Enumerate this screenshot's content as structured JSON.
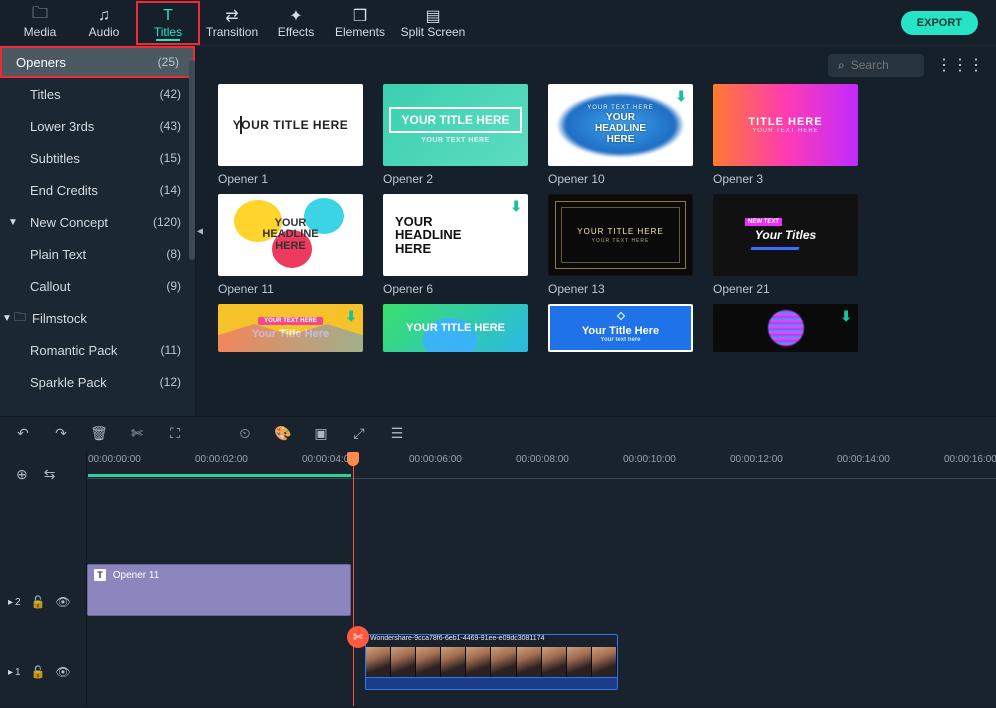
{
  "header": {
    "tabs": [
      {
        "label": "Media"
      },
      {
        "label": "Audio"
      },
      {
        "label": "Titles"
      },
      {
        "label": "Transition"
      },
      {
        "label": "Effects"
      },
      {
        "label": "Elements"
      },
      {
        "label": "Split Screen"
      }
    ],
    "export_label": "EXPORT"
  },
  "search": {
    "placeholder": "Search"
  },
  "sidebar": {
    "items": [
      {
        "label": "Openers",
        "count": "(25)",
        "selected": true
      },
      {
        "label": "Titles",
        "count": "(42)"
      },
      {
        "label": "Lower 3rds",
        "count": "(43)"
      },
      {
        "label": "Subtitles",
        "count": "(15)"
      },
      {
        "label": "End Credits",
        "count": "(14)"
      },
      {
        "label": "New Concept",
        "count": "(120)",
        "chev": "▼"
      },
      {
        "label": "Plain Text",
        "count": "(8)"
      },
      {
        "label": "Callout",
        "count": "(9)"
      },
      {
        "label": "Filmstock",
        "count": "",
        "chev": "▼",
        "folder": true
      },
      {
        "label": "Romantic Pack",
        "count": "(11)"
      },
      {
        "label": "Sparkle Pack",
        "count": "(12)"
      }
    ]
  },
  "thumbs": {
    "r1": [
      {
        "label": "Opener 1",
        "title": "YOUR TITLE HERE"
      },
      {
        "label": "Opener 2",
        "title": "YOUR TITLE HERE",
        "sub": "YOUR TEXT HERE"
      },
      {
        "label": "Opener 10",
        "pre": "YOUR TEXT HERE",
        "title": "YOUR",
        "l2": "HEADLINE",
        "l3": "HERE"
      },
      {
        "label": "Opener 3",
        "title": "TITLE HERE",
        "sub": "YOUR TEXT HERE"
      }
    ],
    "r2": [
      {
        "label": "Opener 11",
        "title": "YOUR",
        "l2": "HEADLINE",
        "l3": "HERE"
      },
      {
        "label": "Opener 6",
        "title": "YOUR",
        "l2": "HEADLINE",
        "l3": "HERE"
      },
      {
        "label": "Opener 13",
        "title": "YOUR TITLE HERE",
        "sub": "YOUR TEXT HERE"
      },
      {
        "label": "Opener 21",
        "title": "Your Titles",
        "tag": "NEW TEXT"
      }
    ],
    "r3": [
      {
        "ribbon": "YOUR TEXT HERE",
        "title": "Your Title Here"
      },
      {
        "title": "YOUR TITLE HERE"
      },
      {
        "title": "Your Title Here",
        "sub": "Your text here"
      },
      {
        "title": ""
      }
    ]
  },
  "ruler": {
    "marks": [
      "00:00:00:00",
      "00:00:02:00",
      "00:00:04:00",
      "00:00:06:00",
      "00:00:08:00",
      "00:00:10:00",
      "00:00:12:00",
      "00:00:14:00",
      "00:00:16:00"
    ]
  },
  "tracks": {
    "track2_label": "2",
    "track1_label": "1",
    "title_clip_label": "Opener 11",
    "video_clip_label": "Wondershare-9cca78f6-6eb1-4469-91ee-e09dc3081174"
  }
}
